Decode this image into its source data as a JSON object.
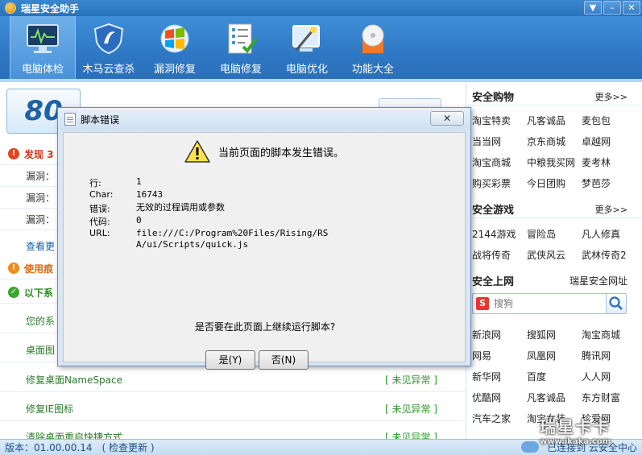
{
  "app": {
    "title": "瑞星安全助手"
  },
  "toolbar": {
    "items": [
      {
        "label": "电脑体检",
        "icon": "monitor-check-icon"
      },
      {
        "label": "木马云查杀",
        "icon": "shield-icon"
      },
      {
        "label": "漏洞修复",
        "icon": "windows-logo-icon"
      },
      {
        "label": "电脑修复",
        "icon": "checklist-icon"
      },
      {
        "label": "电脑优化",
        "icon": "magic-wand-icon"
      },
      {
        "label": "功能大全",
        "icon": "disc-box-icon"
      }
    ]
  },
  "left": {
    "score": "80",
    "rows": [
      {
        "label": "发现 3"
      },
      {
        "label": "漏洞："
      },
      {
        "label": "漏洞："
      },
      {
        "label": "漏洞："
      },
      {
        "label": "查看更"
      },
      {
        "label": "使用痕"
      },
      {
        "label": "以下系"
      },
      {
        "label": "您的系"
      },
      {
        "label": "桌面图"
      },
      {
        "label": "修复桌面NameSpace",
        "status": "[ 未见异常 ]"
      },
      {
        "label": "修复IE图标",
        "status": "[ 未见异常 ]"
      },
      {
        "label": "清除桌面重启快捷方式",
        "status": "[ 未见异常 ]"
      }
    ]
  },
  "right": {
    "shopping": {
      "title": "安全购物",
      "more": "更多>>",
      "links": [
        "淘宝特卖",
        "凡客诚品",
        "麦包包",
        "当当网",
        "京东商城",
        "卓越网",
        "淘宝商城",
        "中粮我买网",
        "麦考林",
        "购买彩票",
        "今日团购",
        "梦芭莎"
      ]
    },
    "games": {
      "title": "安全游戏",
      "more": "更多>>",
      "links": [
        "2144游戏",
        "冒险岛",
        "凡人修真",
        "战将传奇",
        "武侠风云",
        "武林传奇2"
      ]
    },
    "web": {
      "title": "安全上网",
      "site": "瑞星安全网址",
      "search_placeholder": "搜狗",
      "links": [
        "新浪网",
        "搜狐网",
        "淘宝商城",
        "网易",
        "凤凰网",
        "腾讯网",
        "新华网",
        "百度",
        "人人网",
        "优酷网",
        "凡客诚品",
        "东方财富",
        "汽车之家",
        "淘宝女装",
        "珍爱网"
      ]
    }
  },
  "status": {
    "version": "版本：01.00.00.14",
    "update": "( 检查更新 )",
    "connected": "已连接到 云安全中心"
  },
  "watermark": {
    "line1": "瑞星卡卡",
    "line2": "www.ikaka.com"
  },
  "dialog": {
    "title": "脚本错误",
    "headline": "当前页面的脚本发生错误。",
    "fields": [
      {
        "key": "行:",
        "value": "1"
      },
      {
        "key": "Char:",
        "value": "16743"
      },
      {
        "key": "错误:",
        "value": "无效的过程调用或参数"
      },
      {
        "key": "代码:",
        "value": "0"
      },
      {
        "key": "URL:",
        "value": "file:///C:/Program%20Files/Rising/RSA/ui/Scripts/quick.js"
      }
    ],
    "question": "是否要在此页面上继续运行脚本?",
    "yes": "是(Y)",
    "no": "否(N)"
  }
}
